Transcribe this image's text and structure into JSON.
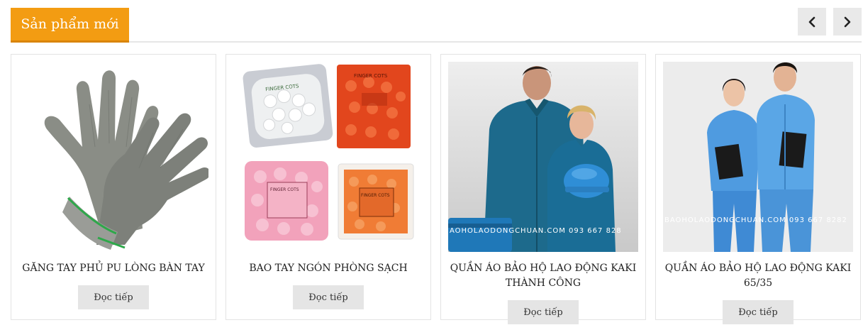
{
  "section": {
    "title": "Sản phẩm mới",
    "prev_icon": "chevron-left-icon",
    "next_icon": "chevron-right-icon",
    "accent_color": "#f39c12"
  },
  "products": [
    {
      "name": "GĂNG TAY PHỦ PU LÒNG BÀN TAY",
      "button": "Đọc tiếp",
      "image": "gray-pu-gloves"
    },
    {
      "name": "BAO TAY NGÓN PHÒNG SẠCH",
      "button": "Đọc tiếp",
      "image": "finger-cots-bags",
      "bag_labels": [
        "FINGER COTS",
        "FINGER COTS",
        "FINGER COTS",
        "FINGER COTS"
      ]
    },
    {
      "name": "QUẦN ÁO BẢO HỘ LAO ĐỘNG KAKI THÀNH CÔNG",
      "button": "Đọc tiếp",
      "image": "teal-work-uniform",
      "watermark": "AOHOLAODONGCHUAN.COM 093 667 828"
    },
    {
      "name": "QUẦN ÁO BẢO HỘ LAO ĐỘNG KAKI 65/35",
      "button": "Đọc tiếp",
      "image": "blue-work-uniform",
      "watermark": "BAOHOLAODONGCHUAN.COM 093 667 8282"
    }
  ]
}
